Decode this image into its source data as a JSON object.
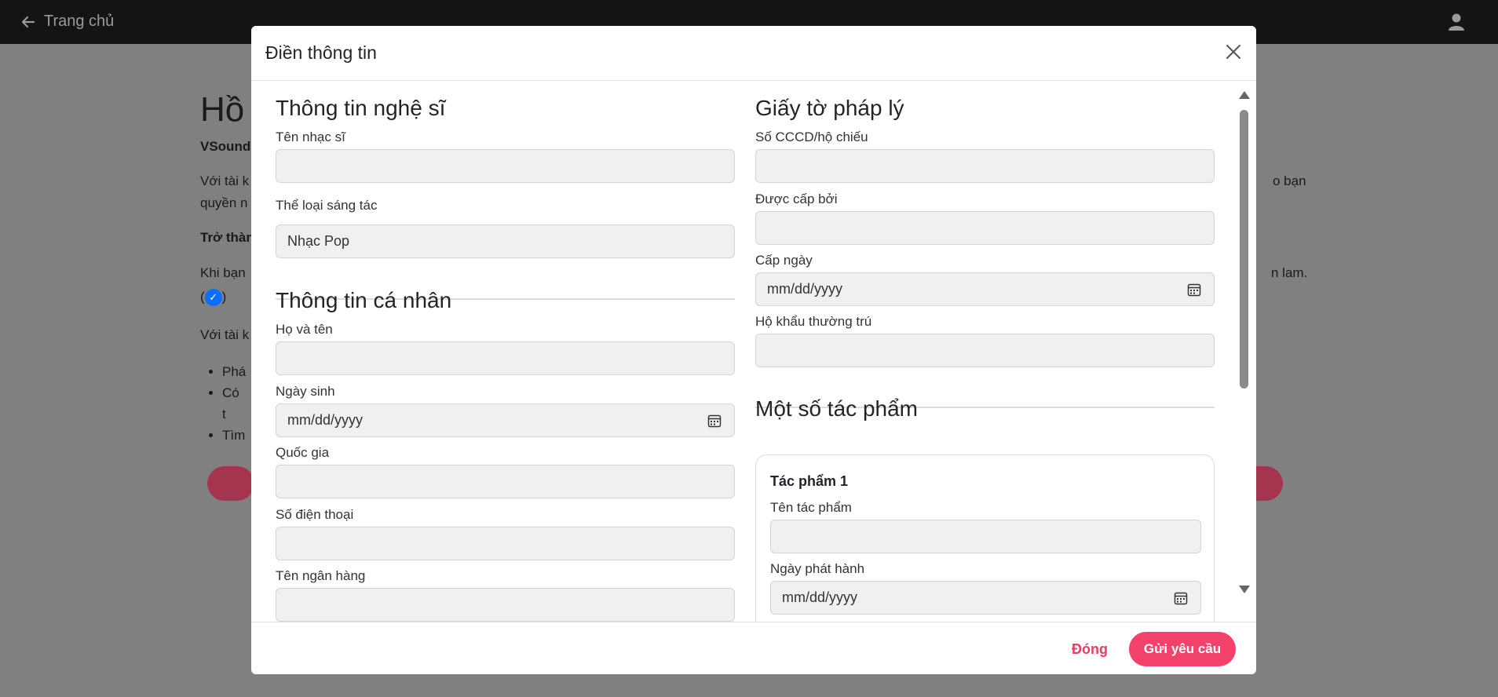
{
  "topbar": {
    "back_label": "Trang chủ"
  },
  "background": {
    "title": "Hồ",
    "brand": "VSound",
    "line1": "Với tài k",
    "line1_right": "o bạn",
    "line2": "quyền n",
    "line3": "Trở thàn",
    "line4": "Khi bạn",
    "line4_right": "n lam.",
    "line5_open": "(",
    "line5_close": ")",
    "line6": "Với tài k",
    "bullets": [
      "Phá",
      "Có t",
      "Tìm"
    ]
  },
  "modal": {
    "title": "Điền thông tin",
    "left": {
      "artist_section": "Thông tin nghệ sĩ",
      "musician_name_label": "Tên nhạc sĩ",
      "musician_name_value": "",
      "genre_label": "Thể loại sáng tác",
      "genre_value": "Nhạc Pop",
      "personal_section": "Thông tin cá nhân",
      "fullname_label": "Họ và tên",
      "fullname_value": "",
      "birthday_label": "Ngày sinh",
      "birthday_placeholder": "mm/dd/yyyy",
      "country_label": "Quốc gia",
      "country_value": "",
      "phone_label": "Số điện thoại",
      "phone_value": "",
      "bank_label": "Tên ngân hàng"
    },
    "right": {
      "legal_section": "Giấy tờ pháp lý",
      "id_label": "Số CCCD/hộ chiếu",
      "id_value": "",
      "issued_by_label": "Được cấp bởi",
      "issued_by_value": "",
      "issue_date_label": "Cấp ngày",
      "issue_date_placeholder": "mm/dd/yyyy",
      "residence_label": "Hộ khẩu thường trú",
      "residence_value": "",
      "works_section": "Một số tác phẩm",
      "work_card": {
        "title": "Tác phẩm 1",
        "name_label": "Tên tác phẩm",
        "name_value": "",
        "release_label": "Ngày phát hành",
        "release_placeholder": "mm/dd/yyyy"
      }
    },
    "footer": {
      "close_label": "Đóng",
      "submit_label": "Gửi yêu cầu"
    }
  },
  "colors": {
    "accent": "#f2416b",
    "close_text": "#e83e64",
    "overlay": "#808080",
    "topbar": "#141414"
  },
  "icons": {
    "back": "arrow-left-icon",
    "user": "user-icon",
    "close": "close-icon",
    "calendar": "calendar-icon",
    "verified": "check-badge-icon"
  }
}
